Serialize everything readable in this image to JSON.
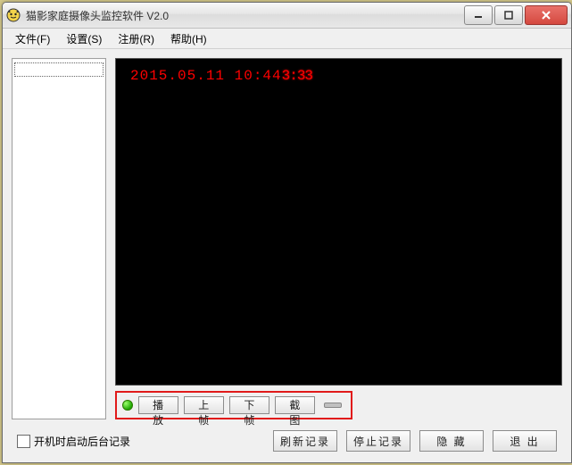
{
  "window": {
    "title": "猫影家庭摄像头监控软件 V2.0"
  },
  "menu": {
    "file": "文件(F)",
    "settings": "设置(S)",
    "register": "注册(R)",
    "help": "帮助(H)"
  },
  "video": {
    "timestamp": "2015.05.11 10:44",
    "timestamp_tail": "3:33"
  },
  "playback": {
    "status_color": "#1ea700",
    "play": "播放",
    "prev_frame": "上帧",
    "next_frame": "下帧",
    "screenshot": "截图"
  },
  "bottom": {
    "autostart_label": "开机时启动后台记录",
    "autostart_checked": false,
    "refresh": "刷新记录",
    "stop": "停止记录",
    "hide": "隐 藏",
    "exit": "退 出"
  }
}
